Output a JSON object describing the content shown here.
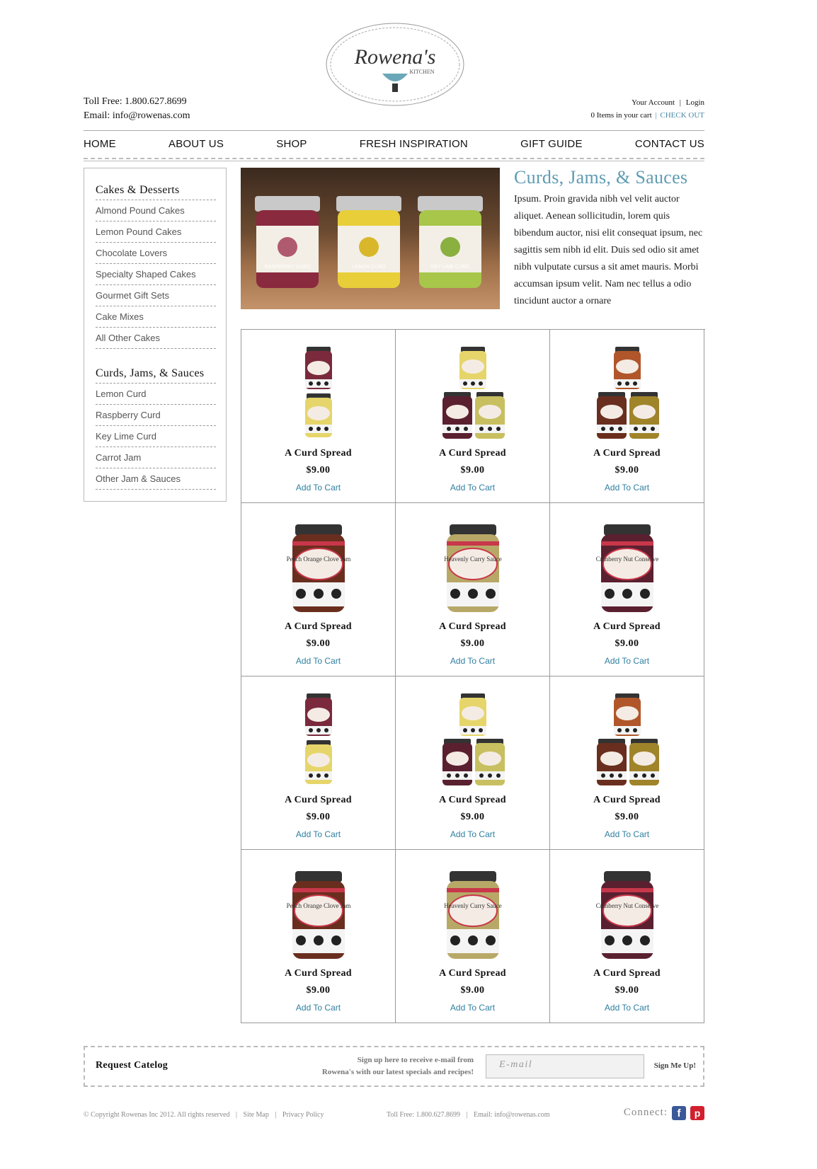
{
  "logo": {
    "main": "Rowena's",
    "sub": "KITCHEN"
  },
  "contact": {
    "toll": "Toll Free: 1.800.627.8699",
    "email": "Email: info@rowenas.com"
  },
  "account": {
    "your_account": "Your Account",
    "sep": "|",
    "login": "Login",
    "cart_items": "0 Items in your cart",
    "checkout": "CHECK OUT"
  },
  "nav": [
    "HOME",
    "ABOUT US",
    "SHOP",
    "FRESH INSPIRATION",
    "GIFT GUIDE",
    "CONTACT US"
  ],
  "sidebar": {
    "cat1": {
      "title": "Cakes & Desserts",
      "items": [
        "Almond Pound Cakes",
        "Lemon Pound Cakes",
        "Chocolate Lovers",
        "Specialty Shaped Cakes",
        "Gourmet Gift Sets",
        "Cake Mixes",
        "All Other Cakes"
      ]
    },
    "cat2": {
      "title": "Curds, Jams, & Sauces",
      "items": [
        "Lemon Curd",
        "Raspberry Curd",
        "Key Lime Curd",
        "Carrot Jam",
        "Other Jam & Sauces"
      ]
    }
  },
  "hero": {
    "title": "Curds, Jams, & Sauces",
    "text": "Ipsum. Proin gravida nibh vel velit auctor aliquet. Aenean sollicitudin, lorem quis bibendum auctor, nisi elit consequat ipsum, nec sagittis sem nibh id elit. Duis sed odio sit amet nibh vulputate cursus a sit amet mauris. Morbi accumsan ipsum velit. Nam nec tellus a odio tincidunt auctor a ornare",
    "jars": [
      "RASPBERRY CURD",
      "LEMON CURD",
      "KEY LIME CURD"
    ]
  },
  "products": [
    {
      "name": "A Curd Spread",
      "price": "$9.00",
      "cart": "Add To Cart",
      "img": "stack-two",
      "color": "#7a2a3c"
    },
    {
      "name": "A Curd Spread",
      "price": "$9.00",
      "cart": "Add To Cart",
      "img": "stack-three",
      "color": "#e6d26a"
    },
    {
      "name": "A Curd Spread",
      "price": "$9.00",
      "cart": "Add To Cart",
      "img": "stack-three-b",
      "color": "#b0562a"
    },
    {
      "name": "A Curd Spread",
      "price": "$9.00",
      "cart": "Add To Cart",
      "img": "jar",
      "color": "#6a2e1e",
      "label": "Peach Orange Clove Jam"
    },
    {
      "name": "A Curd Spread",
      "price": "$9.00",
      "cart": "Add To Cart",
      "img": "jar",
      "color": "#b8a868",
      "label": "Heavenly Curry Sauce"
    },
    {
      "name": "A Curd Spread",
      "price": "$9.00",
      "cart": "Add To Cart",
      "img": "jar",
      "color": "#5a2030",
      "label": "Cranberry Nut Conserve"
    },
    {
      "name": "A Curd Spread",
      "price": "$9.00",
      "cart": "Add To Cart",
      "img": "stack-two",
      "color": "#7a2a3c"
    },
    {
      "name": "A Curd Spread",
      "price": "$9.00",
      "cart": "Add To Cart",
      "img": "stack-three",
      "color": "#e6d26a"
    },
    {
      "name": "A Curd Spread",
      "price": "$9.00",
      "cart": "Add To Cart",
      "img": "stack-three-b",
      "color": "#b0562a"
    },
    {
      "name": "A Curd Spread",
      "price": "$9.00",
      "cart": "Add To Cart",
      "img": "jar",
      "color": "#6a2e1e",
      "label": "Peach Orange Clove Jam"
    },
    {
      "name": "A Curd Spread",
      "price": "$9.00",
      "cart": "Add To Cart",
      "img": "jar",
      "color": "#b8a868",
      "label": "Heavenly Curry Sauce"
    },
    {
      "name": "A Curd Spread",
      "price": "$9.00",
      "cart": "Add To Cart",
      "img": "jar",
      "color": "#5a2030",
      "label": "Cranberry Nut Conserve"
    }
  ],
  "signup": {
    "title": "Request Catelog",
    "msg1": "Sign up here to receive e-mail from",
    "msg2": "Rowena's with our latest specials and recipes!",
    "placeholder": "E-mail",
    "button": "Sign Me Up!"
  },
  "footer": {
    "copyright": "© Copyright Rowenas Inc 2012. All rights reserved",
    "sitemap": "Site Map",
    "privacy": "Privacy Policy",
    "toll": "Toll Free: 1.800.627.8699",
    "email": "Email: info@rowenas.com",
    "connect": "Connect:",
    "fb": "f",
    "pin": "p"
  },
  "colors": {
    "accent": "#5f9cb3",
    "link": "#2f7fa0",
    "border": "#999999"
  }
}
